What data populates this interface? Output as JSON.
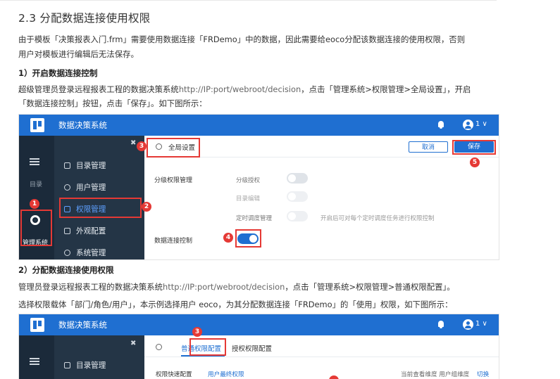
{
  "doc": {
    "section_title": "2.3 分配数据连接使用权限",
    "intro_line1": "由于模板「决策报表入门.frm」需要使用数据连接「FRDemo」中的数据，因此需要给eoco分配该数据连接的使用权限，否则",
    "intro_line2": "用户对模板进行编辑后无法保存。",
    "step1_heading": "1）开启数据连接控制",
    "step1_line1_pre": "超级管理员登录远程报表工程的数据决策系统",
    "step1_line1_url": "http://IP:port/webroot/decision",
    "step1_line1_post": "，点击「管理系统>权限管理>全局设置」，开启",
    "step1_line2": "「数据连接控制」按钮，点击「保存」。如下图所示：",
    "step2_heading": "2）分配数据连接使用权限",
    "step2_line1_pre": "管理员登录远程报表工程的数据决策系统",
    "step2_line1_url": "http://IP:port/webroot/decision",
    "step2_line1_post": "，点击「管理系统>权限管理>普通权限配置」。",
    "step2_line2": "选择权限载体「部门/角色/用户」，本示例选择用户 eoco，为其分配数据连接「FRDemo」的「使用」权限，如下图所示："
  },
  "shot1": {
    "app_title": "数据决策系统",
    "user_count": "1",
    "sidebar_catalog": "目录",
    "sidebar_admin": "管理系统",
    "menu": [
      "目录管理",
      "用户管理",
      "权限管理",
      "外观配置",
      "系统管理"
    ],
    "toolbar_label": "全局设置",
    "cancel": "取消",
    "save": "保存",
    "group1_label": "分级权限管理",
    "opt_grading": "分级授权",
    "opt_catalog_edit": "目录编辑",
    "opt_schedule": "定时调度管理",
    "opt_schedule_hint": "开启后可对每个定时调度任务进行权限控制",
    "group2_label": "数据连接控制",
    "badges": [
      "1",
      "2",
      "3",
      "4",
      "5"
    ]
  },
  "shot2": {
    "app_title": "数据决策系统",
    "user_count": "1",
    "menu_first": "目录管理",
    "tab_normal": "普通权限配置",
    "tab_grant": "授权权限配置",
    "row_label": "权限快速配置",
    "row_link": "用户最终权限",
    "right_text": "当前查看维度 用户组维度",
    "right_link": "切换",
    "badge": "3"
  },
  "colors": {
    "brand": "#1f6fd1",
    "highlight": "#e53935",
    "sidebar": "#1b2a3a"
  }
}
